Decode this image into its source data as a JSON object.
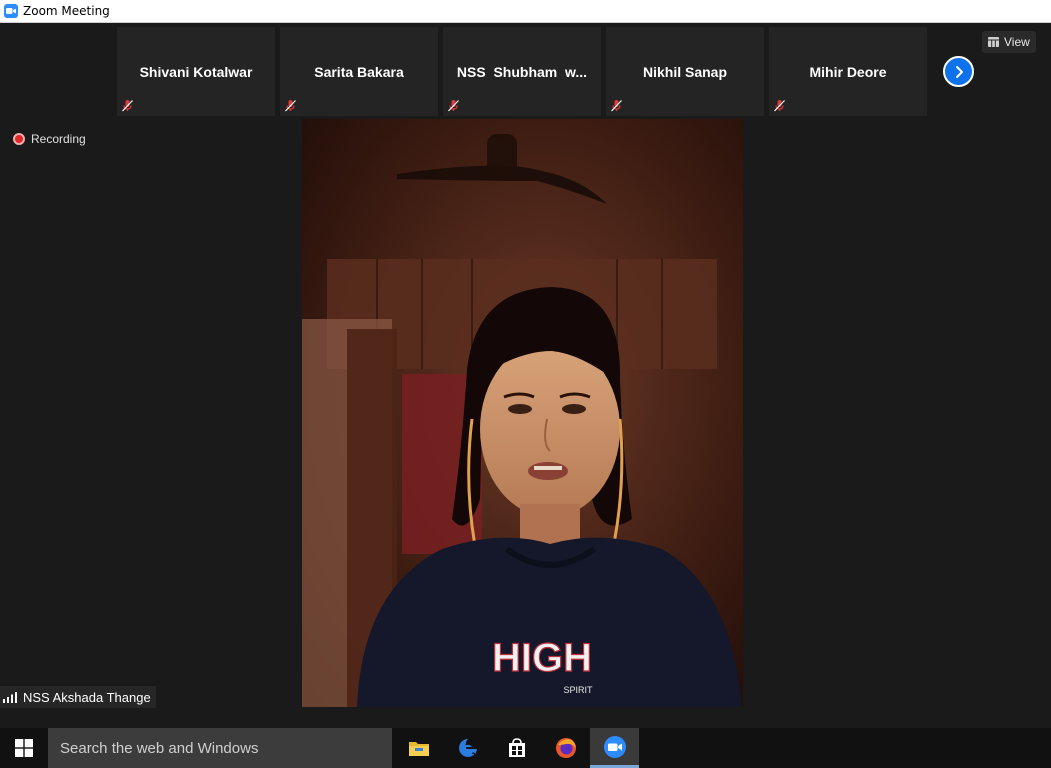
{
  "window": {
    "title": "Zoom Meeting"
  },
  "thumbnails": [
    {
      "name": "Shivani Kotalwar",
      "muted": true
    },
    {
      "name": "Sarita Bakara",
      "muted": true
    },
    {
      "name": "NSS  Shubham  w...",
      "muted": true
    },
    {
      "name": "Nikhil Sanap",
      "muted": true
    },
    {
      "name": "Mihir Deore",
      "muted": true
    }
  ],
  "view_button": {
    "label": "View",
    "icon": "grid-icon"
  },
  "next_button": {
    "icon": "chevron-right-icon"
  },
  "recording": {
    "label": "Recording"
  },
  "active_speaker": {
    "name": "NSS Akshada Thange",
    "shirt_text": "HIGH",
    "shirt_subtext": "SPIRIT"
  },
  "taskbar": {
    "search_placeholder": "Search the web and Windows",
    "icons": [
      "file-explorer-icon",
      "edge-icon",
      "store-icon",
      "firefox-icon",
      "zoom-icon"
    ]
  },
  "colors": {
    "zoom_blue": "#2d8cff",
    "next_button": "#0e72ed",
    "mute_red": "#e03a3a",
    "background": "#1a1a1a"
  }
}
